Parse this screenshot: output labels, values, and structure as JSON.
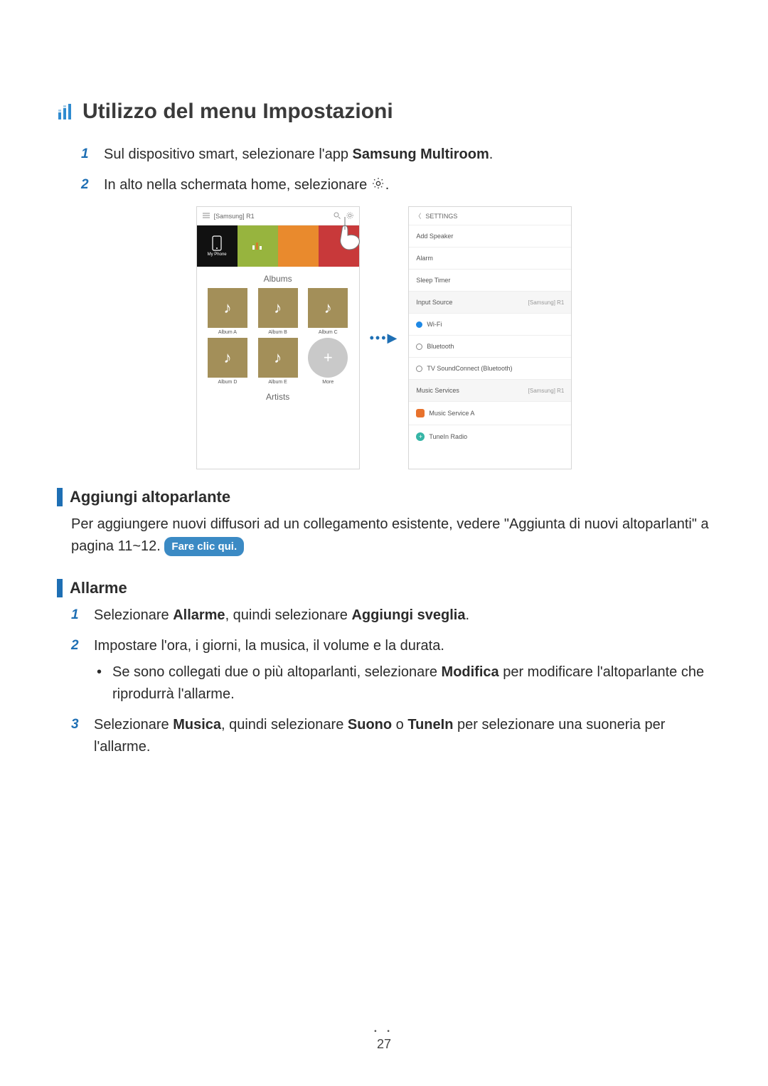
{
  "h1": "Utilizzo del menu Impostazioni",
  "intro": {
    "step1_a": "Sul dispositivo smart, selezionare l'app ",
    "step1_b": "Samsung Multiroom",
    "step1_c": ".",
    "step2_a": "In alto nella schermata home, selezionare ",
    "step2_b": "."
  },
  "phone1": {
    "title": "[Samsung] R1",
    "my_phone": "My Phone",
    "albums_h": "Albums",
    "artists_h": "Artists",
    "albums": [
      "Album A",
      "Album B",
      "Album C",
      "Album D",
      "Album E"
    ],
    "more": "More"
  },
  "phone2": {
    "settings": "SETTINGS",
    "add_speaker": "Add Speaker",
    "alarm": "Alarm",
    "sleep_timer": "Sleep Timer",
    "input_source": "Input Source",
    "input_source_sub": "[Samsung] R1",
    "wifi": "Wi-Fi",
    "bluetooth": "Bluetooth",
    "tvsc": "TV SoundConnect (Bluetooth)",
    "music_services": "Music Services",
    "music_services_sub": "[Samsung] R1",
    "svc_a": "Music Service A",
    "tunein": "TuneIn Radio"
  },
  "aggiungi": {
    "h": "Aggiungi altoparlante",
    "p": "Per aggiungere nuovi diffusori ad un collegamento esistente, vedere \"Aggiunta di nuovi altoparlanti\" a pagina 11~12. ",
    "badge": "Fare clic qui."
  },
  "allarme": {
    "h": "Allarme",
    "s1_a": "Selezionare ",
    "s1_b": "Allarme",
    "s1_c": ", quindi selezionare ",
    "s1_d": "Aggiungi sveglia",
    "s1_e": ".",
    "s2": "Impostare l'ora, i giorni, la musica, il volume e la durata.",
    "s2_b1_a": "Se sono collegati due o più altoparlanti, selezionare ",
    "s2_b1_b": "Modifica",
    "s2_b1_c": " per modificare l'altoparlante che riprodurrà l'allarme.",
    "s3_a": "Selezionare ",
    "s3_b": "Musica",
    "s3_c": ", quindi selezionare ",
    "s3_d": "Suono",
    "s3_e": " o ",
    "s3_f": "TuneIn",
    "s3_g": " per selezionare una suoneria per l'allarme."
  },
  "page_number": "27",
  "nums": {
    "n1": "1",
    "n2": "2",
    "n3": "3"
  },
  "arrow_dots": "•••",
  "arrow_tri": "▶"
}
